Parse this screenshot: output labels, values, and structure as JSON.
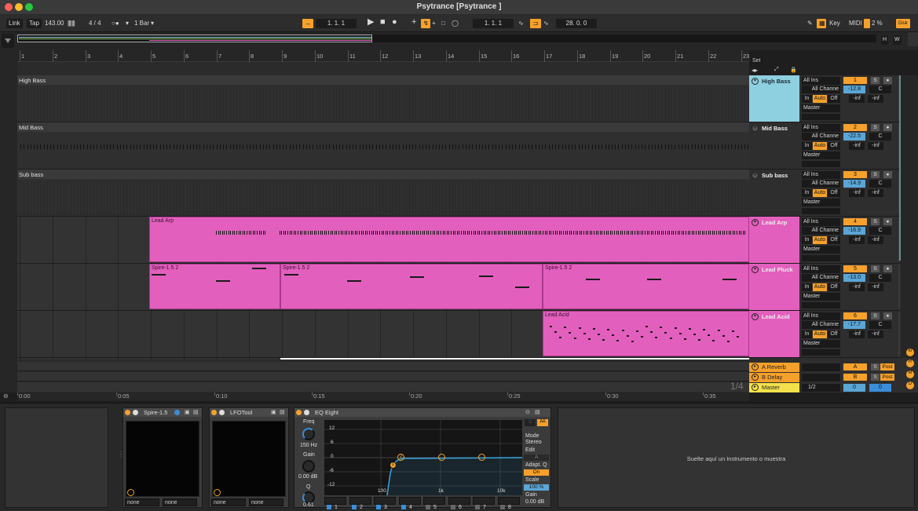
{
  "window": {
    "title": "Psytrance  [Psytrance ]"
  },
  "toolbar": {
    "link": "Link",
    "tap": "Tap",
    "tempo": "143.00",
    "meter_sep": "4 / 4",
    "quant": "1 Bar",
    "pos1": "1.   1.   1",
    "pos2": "1.   1.   1",
    "pos3": "28.   0.   0",
    "key": "Key",
    "midi": "MIDI",
    "cpu": "2 %",
    "disk": "Disk"
  },
  "timeline": {
    "bars": [
      "1",
      "2",
      "3",
      "4",
      "5",
      "6",
      "7",
      "8",
      "9",
      "10",
      "11",
      "12",
      "13",
      "14",
      "15",
      "16",
      "17",
      "18",
      "19",
      "20",
      "21",
      "22",
      "23"
    ],
    "set": "Set"
  },
  "tracks": [
    {
      "name": "High Bass",
      "color": "#8ecfe0",
      "num": "1",
      "vol": "-12.8",
      "pan": "C",
      "input": "All Ins",
      "chan": "All Channe",
      "output": "Master"
    },
    {
      "name": "Mid Bass",
      "color": "#2e2e2e",
      "num": "2",
      "vol": "-22.5",
      "pan": "C",
      "input": "All Ins",
      "chan": "All Channe",
      "output": "Master"
    },
    {
      "name": "Sub bass",
      "color": "#2e2e2e",
      "num": "3",
      "vol": "-14.9",
      "pan": "C",
      "input": "All Ins",
      "chan": "All Channe",
      "output": "Master"
    },
    {
      "name": "Lead Arp",
      "color": "#e35fbd",
      "num": "4",
      "vol": "-16.9",
      "pan": "C",
      "input": "All Ins",
      "chan": "All Channe",
      "output": "Master"
    },
    {
      "name": "Lead Pluck",
      "color": "#e35fbd",
      "num": "5",
      "vol": "-13.0",
      "pan": "C",
      "input": "All Ins",
      "chan": "All Channe",
      "output": "Master"
    },
    {
      "name": "Lead Acid",
      "color": "#e35fbd",
      "num": "6",
      "vol": "-17.7",
      "pan": "C",
      "input": "All Ins",
      "chan": "All Channe",
      "output": "Master"
    }
  ],
  "io_labels": {
    "in": "In",
    "auto": "Auto",
    "off": "Off",
    "inf": "-inf",
    "s": "S"
  },
  "clips": {
    "lead_arp": "Lead Arp",
    "spire1": "Spire-1.5 2",
    "spire2": "Spire-1.5 2",
    "spire3": "Spire-1.5 2",
    "lead_acid": "Lead Acid"
  },
  "returns": [
    {
      "name": "A Reverb",
      "letter": "A",
      "post": "Post"
    },
    {
      "name": "B Delay",
      "letter": "B",
      "post": "Post"
    }
  ],
  "master": {
    "name": "Master",
    "out": "1/2",
    "vol": "0",
    "pan": "0",
    "ratio": "1/4"
  },
  "time_ruler": [
    "0:00",
    "0:05",
    "0:10",
    "0:15",
    "0:20",
    "0:25",
    "0:30",
    "0:35"
  ],
  "devices": {
    "spire": {
      "name": "Spire-1.5",
      "x_param": "none",
      "y_param": "none"
    },
    "lfotool": {
      "name": "LFOTool",
      "x_param": "none",
      "y_param": "none"
    },
    "eq": {
      "name": "EQ Eight",
      "freq_label": "Freq",
      "freq": "150 Hz",
      "gain_label": "Gain",
      "gain": "0.00 dB",
      "q_label": "Q",
      "q": "0.61",
      "db_ticks": [
        "12",
        "6",
        "0",
        "-6",
        "-12"
      ],
      "freq_ticks": [
        "100",
        "1k",
        "10k"
      ],
      "mode_label": "Mode",
      "mode": "Stereo",
      "edit_label": "Edit",
      "edit_val": "A",
      "adapt_label": "Adapt. Q",
      "adapt_val": "On",
      "scale_label": "Scale",
      "scale": "100 %",
      "out_gain_label": "Gain",
      "out_gain": "0.00 dB",
      "bands": [
        "1",
        "2",
        "3",
        "4",
        "5",
        "6",
        "7",
        "8"
      ],
      "point_labels": [
        "1",
        "2"
      ]
    }
  },
  "drop_hint": "Suelte aquí un Instrumento o muestra"
}
